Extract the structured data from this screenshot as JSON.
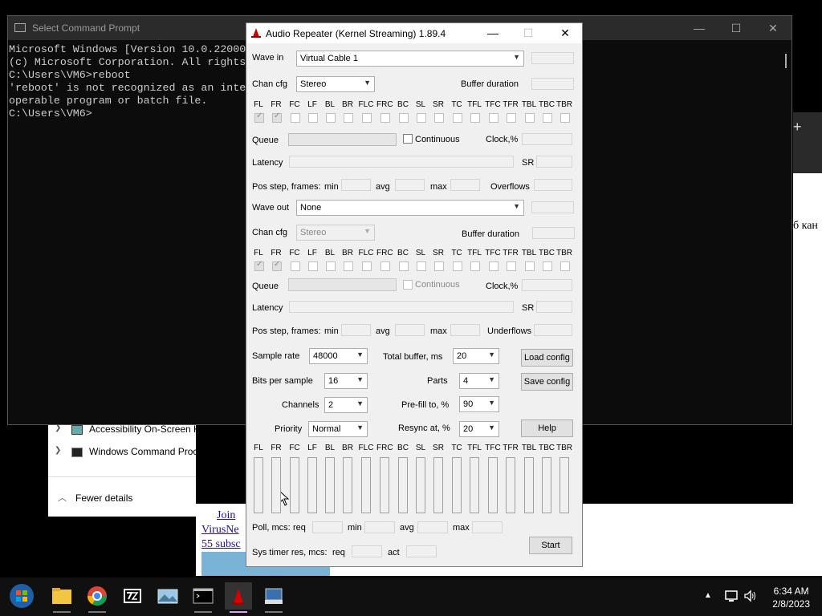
{
  "cmd": {
    "title": "Select Command Prompt",
    "lines": [
      "Microsoft Windows [Version 10.0.22000",
      "(c) Microsoft Corporation. All rights",
      "",
      "C:\\Users\\VM6>reboot",
      "'reboot' is not recognized as an inte",
      "operable program or batch file.",
      "",
      "C:\\Users\\VM6>"
    ]
  },
  "taskmgr": {
    "items": [
      "Accessibility On-Screen K",
      "Windows Command Proc"
    ],
    "fewer_details": "Fewer details"
  },
  "browser": {
    "link1": "Join",
    "link2": "VirusNe",
    "link3": "55 subsc",
    "side_text": "б кан",
    "plus": "+"
  },
  "ar": {
    "title": "Audio Repeater (Kernel Streaming) 1.89.4",
    "wave_in_label": "Wave in",
    "wave_in_value": "Virtual Cable 1",
    "wave_out_label": "Wave out",
    "wave_out_value": "None",
    "chan_cfg_label": "Chan cfg",
    "chan_cfg_in": "Stereo",
    "chan_cfg_out": "Stereo",
    "buffer_duration": "Buffer duration",
    "channels": [
      "FL",
      "FR",
      "FC",
      "LF",
      "BL",
      "BR",
      "FLC",
      "FRC",
      "BC",
      "SL",
      "SR",
      "TC",
      "TFL",
      "TFC",
      "TFR",
      "TBL",
      "TBC",
      "TBR"
    ],
    "queue": "Queue",
    "continuous": "Continuous",
    "clock": "Clock,%",
    "latency": "Latency",
    "sr": "SR",
    "pos_step": "Pos step, frames:",
    "min": "min",
    "avg": "avg",
    "max": "max",
    "overflows": "Overflows",
    "underflows": "Underflows",
    "sample_rate_label": "Sample rate",
    "sample_rate": "48000",
    "bits_label": "Bits per sample",
    "bits": "16",
    "channels_label": "Channels",
    "channels_value": "2",
    "priority_label": "Priority",
    "priority": "Normal",
    "total_buffer_label": "Total buffer, ms",
    "total_buffer": "20",
    "parts_label": "Parts",
    "parts": "4",
    "prefill_label": "Pre-fill to, %",
    "prefill": "90",
    "resync_label": "Resync at, %",
    "resync": "20",
    "load_config": "Load config",
    "save_config": "Save config",
    "help": "Help",
    "poll_label": "Poll, mcs:",
    "req": "req",
    "sys_timer_label": "Sys timer res, mcs:",
    "act": "act",
    "start": "Start"
  },
  "taskbar": {
    "time": "6:34 AM",
    "date": "2/8/2023"
  }
}
